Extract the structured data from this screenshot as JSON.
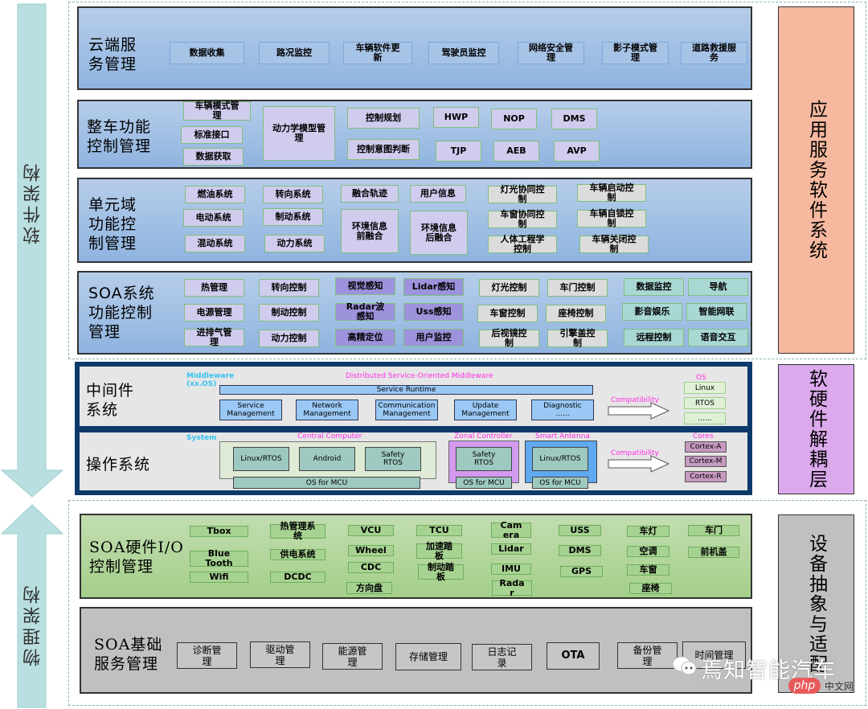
{
  "left_arrows": {
    "software": {
      "label": "软件架构",
      "direction": "down",
      "color": "#b9dfe0"
    },
    "physical": {
      "label": "物理架构",
      "direction": "up",
      "color": "#b9dfe0"
    }
  },
  "right_labels": {
    "app": {
      "label": "应用服务软件系统",
      "color": "#f6b9a0"
    },
    "decouple": {
      "label": "软硬件解耦层",
      "color": "#dba9ec"
    },
    "device": {
      "label": "设备抽象与适配",
      "color": "#c0c0c0"
    }
  },
  "layers": {
    "cloud": {
      "title": "云端服\n务管理",
      "items": [
        "数据收集",
        "路况监控",
        "车辆软件更\n新",
        "驾驶员监控",
        "网络安全管\n理",
        "影子模式管\n理",
        "道路救援服\n务"
      ]
    },
    "vehicle": {
      "title": "整车功能\n控制管理",
      "items": [
        "车辆模式管\n理",
        "标准接口",
        "数据获取",
        "动力学模型管\n理",
        "控制规划",
        "控制意图判断",
        "HWP",
        "NOP",
        "DMS",
        "TJP",
        "AEB",
        "AVP"
      ]
    },
    "unit": {
      "title": "单元域\n功能控\n制管理",
      "items": [
        "燃油系统",
        "转向系统",
        "融合轨迹",
        "用户信息",
        "电动系统",
        "制动系统",
        "环境信息\n前融合",
        "环境信息\n后融合",
        "混动系统",
        "动力系统",
        "灯光协同控\n制",
        "车辆启动控\n制",
        "车窗协同控\n制",
        "车辆自锁控\n制",
        "人体工程学\n控制",
        "车辆关闭控\n制"
      ]
    },
    "soa_sys": {
      "title": "SOA系统\n功能控制\n管理",
      "items": [
        "热管理",
        "转向控制",
        "视觉感知",
        "Lidar感知",
        "灯光控制",
        "车门控制",
        "数据监控",
        "导航",
        "电源管理",
        "制动控制",
        "Radar波\n感知",
        "Uss感知",
        "车窗控制",
        "座椅控制",
        "影音娱乐",
        "智能网联",
        "进排气管\n理",
        "动力控制",
        "高精定位",
        "用户监控",
        "后视镜控\n制",
        "引擎盖控\n制",
        "远程控制",
        "语音交互"
      ]
    },
    "middleware": {
      "title": "中间件\n系统",
      "tag": "Middleware\n(xx.OS)",
      "header": "Distributed  Service-Oriented  Middleware",
      "runtime": "Service Runtime",
      "items": [
        "Service\nManagement",
        "Network\nManagement",
        "Communication\nManagement",
        "Update\nManagement",
        "Diagnostic\n......"
      ],
      "compat": "Compatibility",
      "os_title": "OS",
      "os_items": [
        "Linux",
        "RTOS",
        "......"
      ]
    },
    "os": {
      "title": "操作系统",
      "tag": "System",
      "central": {
        "label": "Central  Computer",
        "items": [
          "Linux/RTOS",
          "Android",
          "Safety\nRTOS"
        ],
        "mcu": "OS for MCU"
      },
      "zonal": {
        "label": "Zonal Controller",
        "item": "Safety\nRTOS",
        "mcu": "OS for MCU"
      },
      "antenna": {
        "label": "Smart Antenna",
        "item": "Linux/RTOS",
        "mcu": "OS for MCU"
      },
      "compat": "Compatibility",
      "cores_title": "Cores",
      "cores": [
        "Cortex-A",
        "Cortex-M",
        "Cortex-R"
      ]
    },
    "hw_io": {
      "title": "SOA硬件I/O\n控制管理",
      "items": [
        "Tbox",
        "Blue\nTooth",
        "Wifi",
        "热管理系\n统",
        "供电系统",
        "DCDC",
        "VCU",
        "Wheel",
        "CDC",
        "方向盘",
        "TCU",
        "加速踏\n板",
        "制动踏\n板",
        "Cam\nera",
        "Lidar",
        "IMU",
        "Rada\nr",
        "USS",
        "DMS",
        "GPS",
        "车灯",
        "空调",
        "车窗",
        "座椅",
        "车门",
        "前机盖"
      ]
    },
    "base": {
      "title": "SOA基础\n服务管理",
      "items": [
        "诊断管\n理",
        "驱动管\n理",
        "能源管\n理",
        "存储管理",
        "日志记\n录",
        "OTA",
        "备份管\n理",
        "时间管理"
      ]
    }
  },
  "watermark": {
    "text": "焉知智能汽车",
    "site_badge": "php",
    "site_text": "中文网"
  }
}
